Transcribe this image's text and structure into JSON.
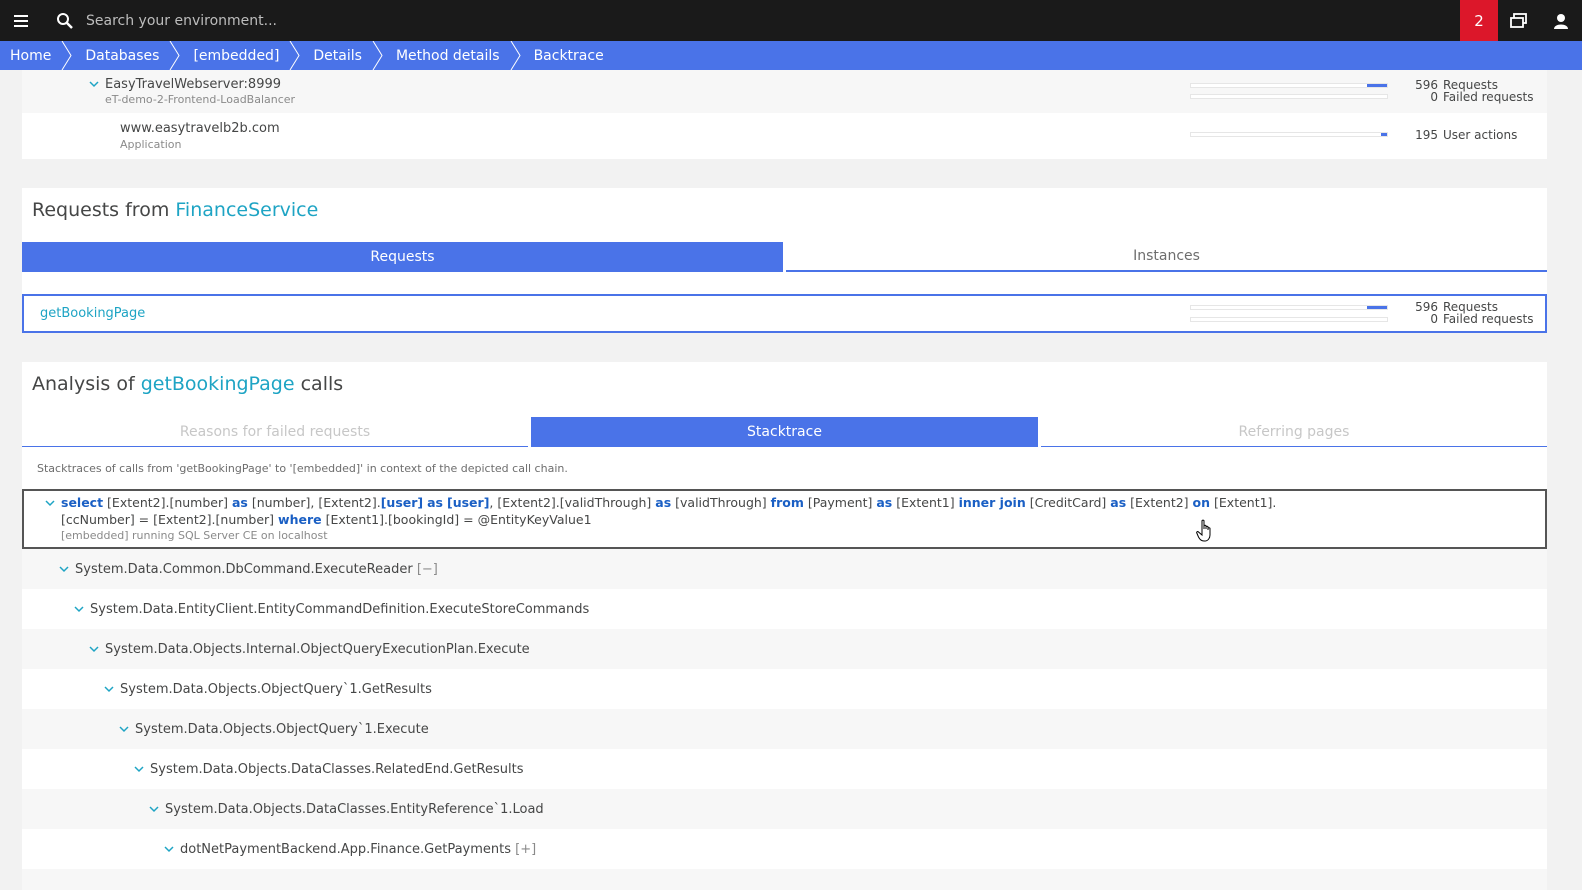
{
  "topbar": {
    "search_placeholder": "Search your environment...",
    "notification_count": "2"
  },
  "breadcrumb": [
    "Home",
    "Databases",
    "[embedded]",
    "Details",
    "Method details",
    "Backtrace"
  ],
  "call_chain": [
    {
      "name": "EasyTravelWebserver:8999",
      "subtitle": "eT-demo-2-Frontend-LoadBalancer",
      "stat1_value": "596",
      "stat1_label": "Requests",
      "stat2_value": "0",
      "stat2_label": "Failed requests",
      "bar_fraction": 0.1
    },
    {
      "name": "www.easytravelb2b.com",
      "subtitle": "Application",
      "stat1_value": "195",
      "stat1_label": "User actions",
      "bar_fraction": 0.03
    }
  ],
  "requests_panel": {
    "title_prefix": "Requests from",
    "title_link": "FinanceService",
    "tab_requests": "Requests",
    "tab_instances": "Instances",
    "item": {
      "name": "getBookingPage",
      "stat1_value": "596",
      "stat1_label": "Requests",
      "stat2_value": "0",
      "stat2_label": "Failed requests",
      "bar_fraction": 0.1
    }
  },
  "analysis_panel": {
    "title_prefix": "Analysis of",
    "title_link": "getBookingPage",
    "title_suffix": "calls",
    "tabs": [
      "Reasons for failed requests",
      "Stacktrace",
      "Referring pages"
    ],
    "description": "Stacktraces of calls from 'getBookingPage' to '[embedded]' in context of the depicted call chain.",
    "sql": {
      "kw_select": "select",
      "p1": " [Extent2].[number] ",
      "kw_as1": "as",
      "p2": " [number], [Extent2].",
      "kw_user1": "[user]",
      "p3": " ",
      "kw_as2": "as",
      "p4": " ",
      "kw_user2": "[user]",
      "p5": ", [Extent2].[validThrough] ",
      "kw_as3": "as",
      "p6": " [validThrough] ",
      "kw_from": "from",
      "p7": " [Payment] ",
      "kw_as4": "as",
      "p8": " [Extent1] ",
      "kw_inner": "inner join",
      "p9": " [CreditCard] ",
      "kw_as5": "as",
      "p10": " [Extent2] ",
      "kw_on": "on",
      "p11": " [Extent1].",
      "line2_a": "[ccNumber] = [Extent2].[number] ",
      "kw_where": "where",
      "line2_b": " [Extent1].[bookingId] = @EntityKeyValue1",
      "db_info": "[embedded] running SQL Server CE on localhost"
    },
    "frames": [
      {
        "method": "System.Data.Common.DbCommand.ExecuteReader",
        "suffix": "[−]"
      },
      {
        "method": "System.Data.EntityClient.EntityCommandDefinition.ExecuteStoreCommands",
        "suffix": ""
      },
      {
        "method": "System.Data.Objects.Internal.ObjectQueryExecutionPlan.Execute",
        "suffix": ""
      },
      {
        "method": "System.Data.Objects.ObjectQuery`1.GetResults",
        "suffix": ""
      },
      {
        "method": "System.Data.Objects.ObjectQuery`1.Execute",
        "suffix": ""
      },
      {
        "method": "System.Data.Objects.DataClasses.RelatedEnd.GetResults",
        "suffix": ""
      },
      {
        "method": "System.Data.Objects.DataClasses.EntityReference`1.Load",
        "suffix": ""
      },
      {
        "method": "dotNetPaymentBackend.App.Finance.GetPayments",
        "suffix": "[+]"
      }
    ]
  },
  "colors": {
    "accent": "#4a73e8",
    "link": "#1ea4c4",
    "alert": "#dc172a",
    "topbar": "#1a1a1a"
  }
}
